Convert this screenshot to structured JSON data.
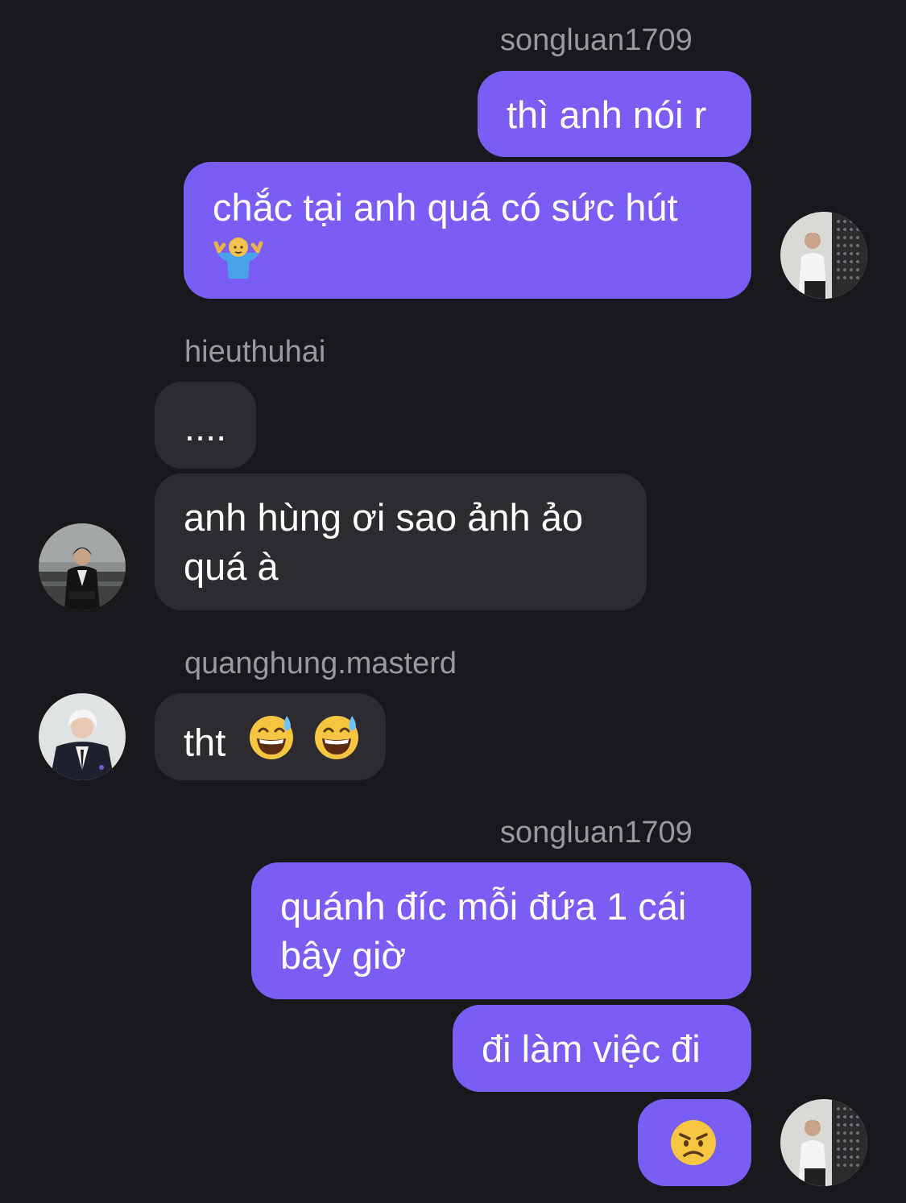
{
  "conversation": {
    "messages": [
      {
        "sender": "songluan1709",
        "text": "thì anh nói r"
      },
      {
        "text": "chắc tại anh quá có sức hút"
      },
      {
        "sender": "hieuthuhai",
        "text": "...."
      },
      {
        "text_line1": "anh hùng ơi sao ảnh ảo",
        "text_line2": "quá à"
      },
      {
        "sender": "quanghung.masterd",
        "text": "tht"
      },
      {
        "sender": "songluan1709",
        "text_line1": "quánh đíc mỗi đứa 1 cái",
        "text_line2": "bây giờ"
      },
      {
        "text": "đi làm việc đi"
      },
      {
        "emoji": "angry-face-emoji"
      }
    ]
  },
  "icons": {
    "shrug": "person-shrugging-emoji",
    "sweat": "grinning-sweat-emoji",
    "angry": "angry-face-emoji"
  },
  "colors": {
    "background": "#19181d",
    "outgoing_bubble": "#7a5df2",
    "incoming_bubble": "#2c2b30",
    "sender_name": "#9a999e"
  }
}
